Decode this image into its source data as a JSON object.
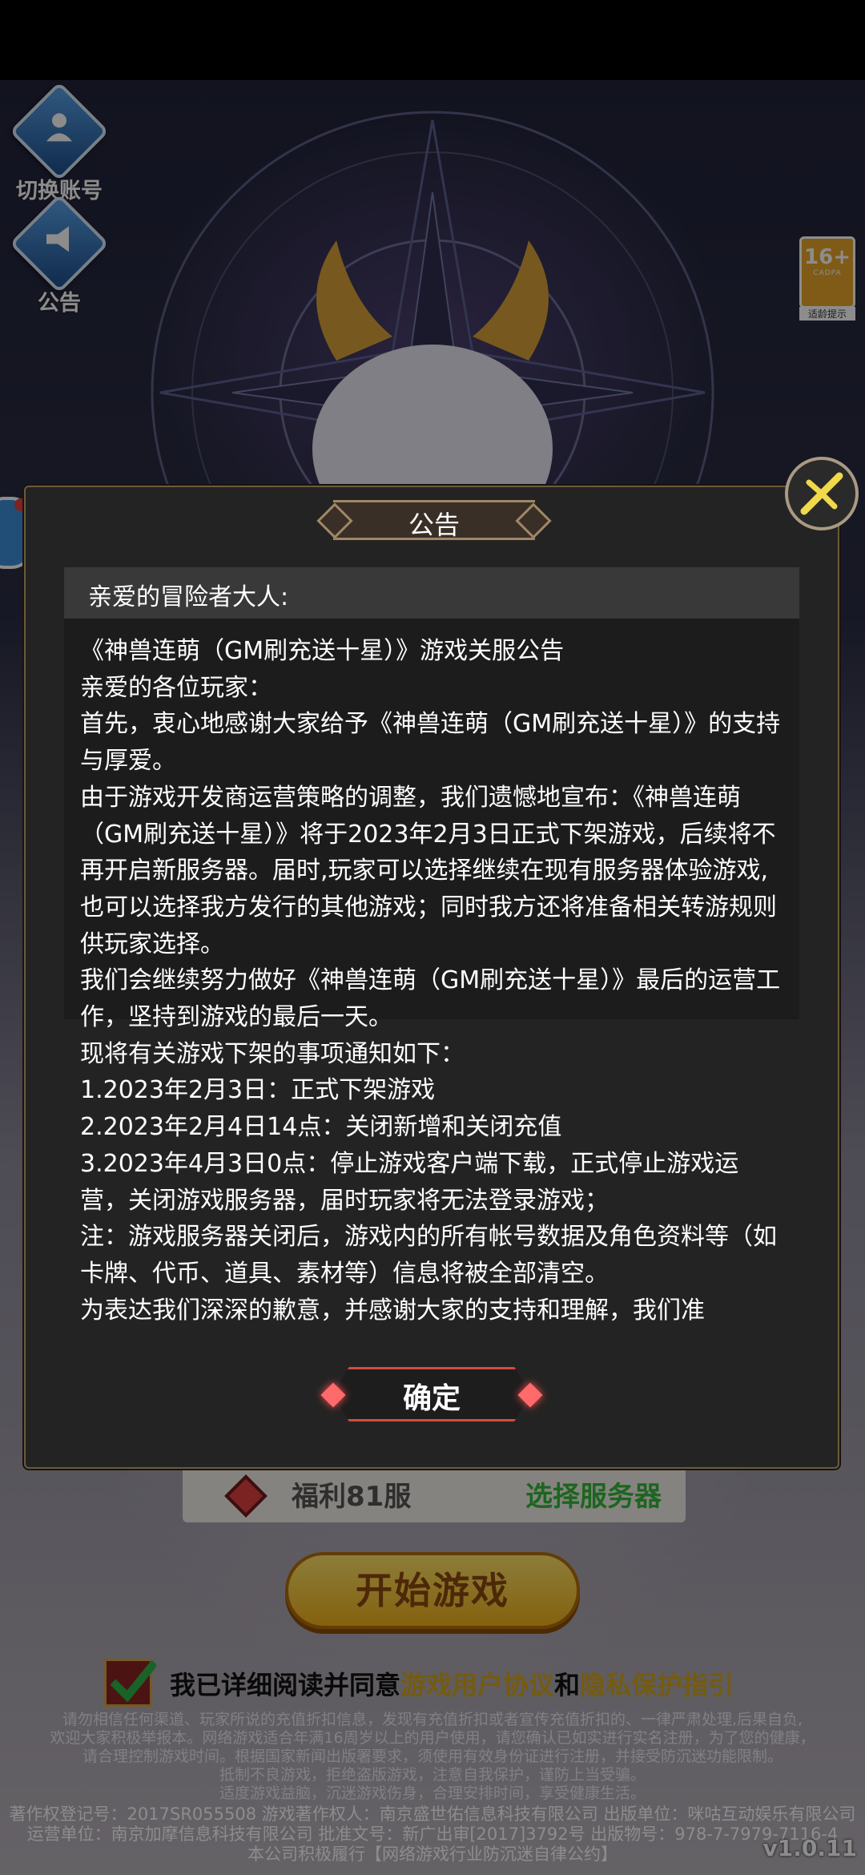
{
  "left_buttons": {
    "switch_account": "切换账号",
    "announcement": "公告"
  },
  "age_rating": {
    "age": "16+",
    "org": "CADPA",
    "tip": "适龄提示"
  },
  "dialog": {
    "title": "公告",
    "greeting": "亲爱的冒险者大人:",
    "paragraphs": [
      "《神兽连萌（GM刷充送十星）》游戏关服公告",
      "亲爱的各位玩家：",
      "首先，衷心地感谢大家给予《神兽连萌（GM刷充送十星）》的支持与厚爱。",
      "由于游戏开发商运营策略的调整，我们遗憾地宣布：《神兽连萌（GM刷充送十星）》将于2023年2月3日正式下架游戏，后续将不再开启新服务器。届时,玩家可以选择继续在现有服务器体验游戏,也可以选择我方发行的其他游戏；同时我方还将准备相关转游规则供玩家选择。",
      "我们会继续努力做好《神兽连萌（GM刷充送十星）》最后的运营工作，坚持到游戏的最后一天。",
      "现将有关游戏下架的事项通知如下：",
      "1.2023年2月3日：正式下架游戏",
      "2.2023年2月4日14点：关闭新增和关闭充值",
      "3.2023年4月3日0点：停止游戏客户端下载，正式停止游戏运营，关闭游戏服务器，届时玩家将无法登录游戏；",
      "注：游戏服务器关闭后，游戏内的所有帐号数据及角色资料等（如卡牌、代币、道具、素材等）信息将被全部清空。",
      "为表达我们深深的歉意，并感谢大家的支持和理解，我们准"
    ],
    "confirm_label": "确定"
  },
  "server": {
    "name": "福利81服",
    "choose_label": "选择服务器"
  },
  "start_label": "开始游戏",
  "agreement": {
    "prefix": "我已详细阅读并同意",
    "user_agreement": "游戏用户协议",
    "and": "和",
    "privacy": "隐私保护指引"
  },
  "legal": {
    "line1": "请勿相信任何渠道、玩家所说的充值折扣信息，发现有充值折扣或者宣传充值折扣的、一律严肃处理,后果自负,",
    "line2": "欢迎大家积极举报本。网络游戏适合年满16周岁以上的用户使用，请您确认已如实进行实名注册，为了您的健康，",
    "line3": "请合理控制游戏时间。根据国家新闻出版署要求，须使用有效身份证进行注册，并接受防沉迷功能限制。",
    "line4": "抵制不良游戏，拒绝盗版游戏，注意自我保护，谨防上当受骗。",
    "line5": "适度游戏益脑，沉迷游戏伤身，合理安排时间，享受健康生活。",
    "copyright1": "著作权登记号：2017SR055508 游戏著作权人：南京盛世佑信息科技有限公司 出版单位：咪咕互动娱乐有限公司",
    "copyright2": "运营单位：南京加摩信息科技有限公司 批准文号：新广出审[2017]3792号 出版物号：978-7-7979-7116-4",
    "copyright3": "本公司积极履行【网络游戏行业防沉迷自律公约】"
  },
  "version": "v1.0.11"
}
